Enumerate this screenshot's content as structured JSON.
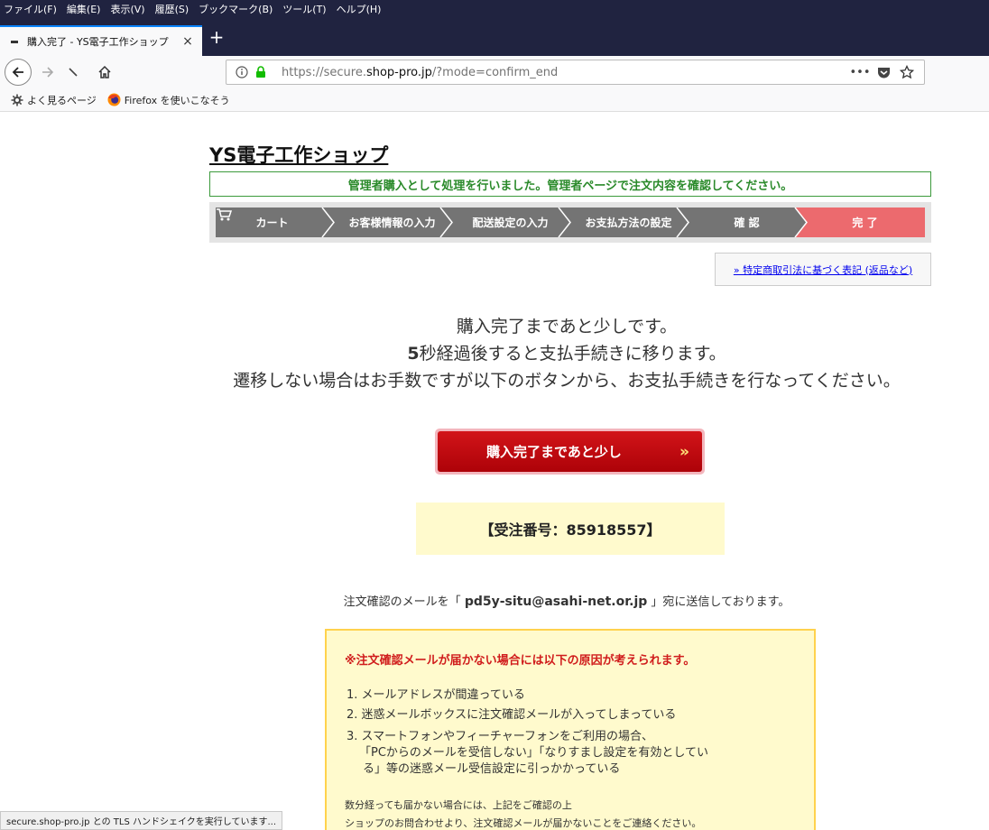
{
  "menubar": {
    "items": [
      "ファイル(F)",
      "編集(E)",
      "表示(V)",
      "履歴(S)",
      "ブックマーク(B)",
      "ツール(T)",
      "ヘルプ(H)"
    ]
  },
  "tab": {
    "title": "購入完了 - YS電子工作ショップ",
    "close": "×",
    "new_tab": "+"
  },
  "urlbar": {
    "scheme_prefix": "https://secure.",
    "domain": "shop-pro.jp",
    "path": "/?mode=confirm_end",
    "more": "•••"
  },
  "bookmarks": [
    {
      "label": "よく見るページ"
    },
    {
      "label": "Firefox を使いこなそう"
    }
  ],
  "shop": {
    "title": "YS電子工作ショップ",
    "admin_notice": "管理者購入として処理を行いました。管理者ページで注文内容を確認してください。"
  },
  "steps": [
    {
      "label": "カート",
      "active": false
    },
    {
      "label": "お客様情報の入力",
      "active": false
    },
    {
      "label": "配送設定の入力",
      "active": false
    },
    {
      "label": "お支払方法の設定",
      "active": false
    },
    {
      "label": "確 認",
      "active": false
    },
    {
      "label": "完 了",
      "active": true
    }
  ],
  "colors": {
    "step_inactive": "#747474",
    "step_active": "#ec6a6e",
    "separator": "#ffffff"
  },
  "tokutei_link": "» 特定商取引法に基づく表記 (返品など)",
  "message": {
    "line1": "購入完了まであと少しです。",
    "line2_num": "5",
    "line2_rest": "秒経過後すると支払手続きに移ります。",
    "line3": "遷移しない場合はお手数ですが以下のボタンから、お支払手続きを行なってください。"
  },
  "buy_button": {
    "label": "購入完了まであと少し",
    "arrow": "»"
  },
  "order": {
    "text": "【受注番号：85918557】"
  },
  "mail": {
    "prefix": "注文確認のメールを「",
    "address": "pd5y-situ@asahi-net.or.jp",
    "suffix": "」宛に送信しております。"
  },
  "warning": {
    "heading": "※注文確認メールが届かない場合には以下の原因が考えられます。",
    "items": [
      "1. メールアドレスが間違っている",
      "2. 迷惑メールボックスに注文確認メールが入ってしまっている",
      "3. スマートフォンやフィーチャーフォンをご利用の場合、",
      "「PCからのメールを受信しない」「なりすまし設定を有効としてい",
      "る」等の迷惑メール受信設定に引っかかっている"
    ],
    "note_lines": [
      "数分経っても届かない場合には、上記をご確認の上",
      "ショップのお問合わせより、注文確認メールが届かないことをご連絡ください。"
    ]
  },
  "statusbar": {
    "text": "secure.shop-pro.jp との TLS ハンドシェイクを実行しています..."
  }
}
